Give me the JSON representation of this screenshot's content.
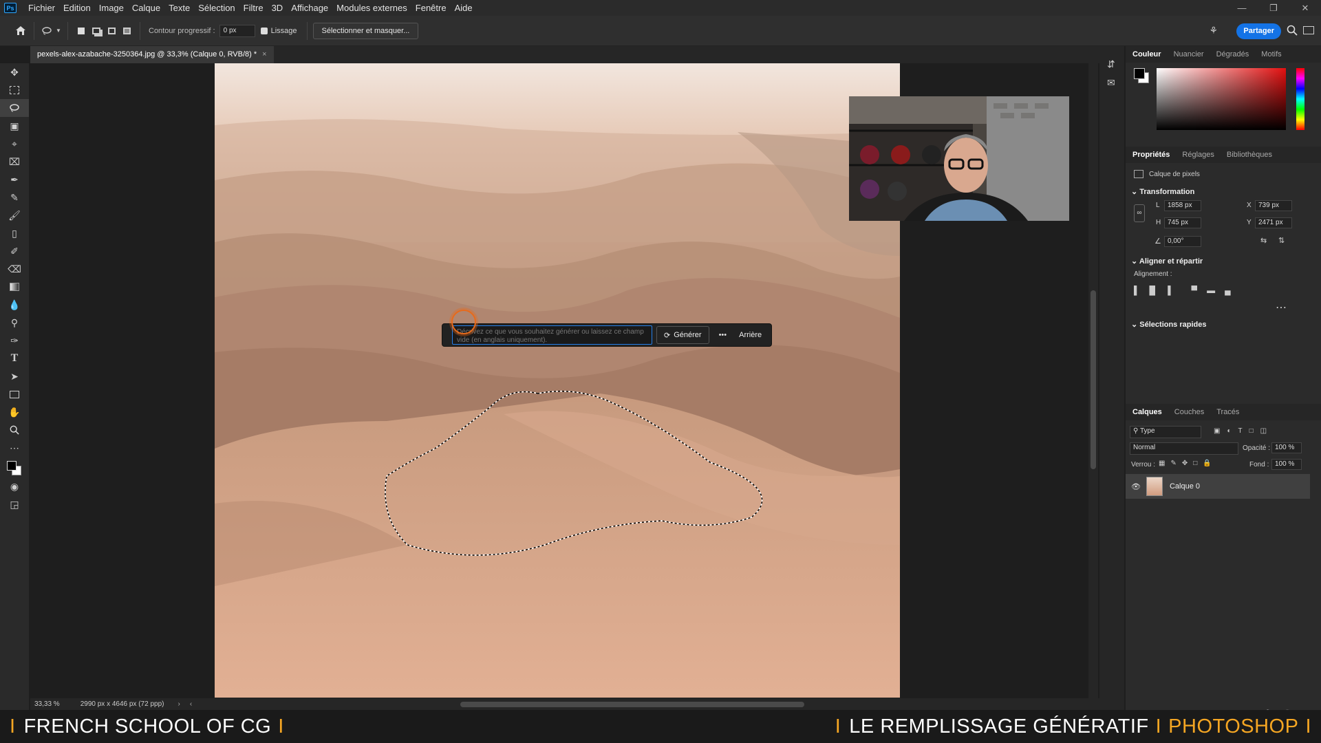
{
  "menubar": {
    "app_logo": "Ps",
    "items": [
      "Fichier",
      "Edition",
      "Image",
      "Calque",
      "Texte",
      "Sélection",
      "Filtre",
      "3D",
      "Affichage",
      "Modules externes",
      "Fenêtre",
      "Aide"
    ]
  },
  "options_bar": {
    "feather_label": "Contour progressif :",
    "feather_value": "0 px",
    "antialias_label": "Lissage",
    "select_mask_label": "Sélectionner et masquer...",
    "share_label": "Partager"
  },
  "document": {
    "tab_title": "pexels-alex-azabache-3250364.jpg @ 33,3% (Calque 0, RVB/8) *"
  },
  "contextual_bar": {
    "prompt_placeholder": "Décrivez ce que vous souhaitez générer ou laissez ce champ vide (en anglais uniquement).",
    "generate_label": "Générer",
    "more_label": "•••",
    "back_label": "Arrière"
  },
  "color_panel": {
    "tabs": [
      "Couleur",
      "Nuancier",
      "Dégradés",
      "Motifs"
    ]
  },
  "properties_panel": {
    "tabs": [
      "Propriétés",
      "Réglages",
      "Bibliothèques"
    ],
    "layer_type": "Calque de pixels",
    "transform_title": "Transformation",
    "w_label": "L",
    "w_value": "1858 px",
    "h_label": "H",
    "h_value": "745 px",
    "x_label": "X",
    "x_value": "739 px",
    "y_label": "Y",
    "y_value": "2471 px",
    "angle_value": "0,00°",
    "align_title": "Aligner et répartir",
    "align_label": "Alignement :",
    "quick_sel_title": "Sélections rapides"
  },
  "layers_panel": {
    "tabs": [
      "Calques",
      "Couches",
      "Tracés"
    ],
    "filter_label": "Type",
    "blend_mode": "Normal",
    "opacity_label": "Opacité :",
    "opacity_value": "100 %",
    "lock_label": "Verrou :",
    "fill_label": "Fond :",
    "fill_value": "100 %",
    "layer_name": "Calque 0"
  },
  "status_bar": {
    "zoom": "33,33 %",
    "doc_info": "2990 px x 4646 px (72 ppp)"
  },
  "banner": {
    "left_text": "FRENCH SCHOOL OF CG",
    "right_text_1": "LE REMPLISSAGE GÉNÉRATIF",
    "right_text_2": "PHOTOSHOP",
    "separator": "I"
  }
}
